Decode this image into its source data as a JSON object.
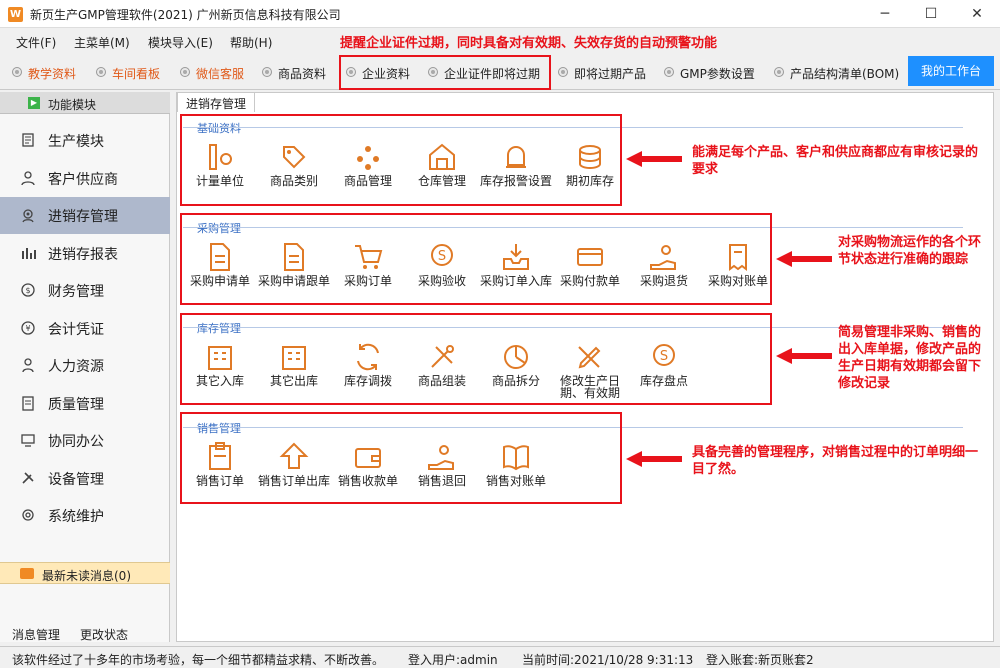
{
  "window": {
    "title": "新页生产GMP管理软件(2021) 广州新页信息科技有限公司",
    "icon_glyph": "W",
    "controls": {
      "minimize": "─",
      "maximize": "☐",
      "close": "✕"
    }
  },
  "menu": {
    "items": [
      "文件(F)",
      "主菜单(M)",
      "模块导入(E)",
      "帮助(H)"
    ]
  },
  "banner": "提醒企业证件过期，同时具备对有效期、失效存货的自动预警功能",
  "quickbar": {
    "items": [
      "教学资料",
      "车间看板",
      "微信客服",
      "商品资料",
      "企业资料",
      "企业证件即将过期",
      "即将过期产品",
      "GMP参数设置",
      "产品结构清单(BOM)"
    ],
    "workbench": "我的工作台"
  },
  "sidebar": {
    "header": "功能模块",
    "items": [
      "生产模块",
      "客户供应商",
      "进销存管理",
      "进销存报表",
      "财务管理",
      "会计凭证",
      "人力资源",
      "质量管理",
      "协同办公",
      "设备管理",
      "系统维护"
    ],
    "active_index": 2,
    "unread": "最新未读消息(0)",
    "footer": [
      "消息管理",
      "更改状态"
    ]
  },
  "main": {
    "tab": "进销存管理",
    "sections": [
      {
        "title": "基础资料",
        "items": [
          "计量单位",
          "商品类别",
          "商品管理",
          "仓库管理",
          "库存报警设置",
          "期初库存"
        ]
      },
      {
        "title": "采购管理",
        "items": [
          "采购申请单",
          "采购申请跟单",
          "采购订单",
          "采购验收",
          "采购订单入库",
          "采购付款单",
          "采购退货",
          "采购对账单"
        ]
      },
      {
        "title": "库存管理",
        "items": [
          "其它入库",
          "其它出库",
          "库存调拨",
          "商品组装",
          "商品拆分",
          "修改生产日期、有效期",
          "库存盘点"
        ]
      },
      {
        "title": "销售管理",
        "items": [
          "销售订单",
          "销售订单出库",
          "销售收款单",
          "销售退回",
          "销售对账单"
        ]
      }
    ],
    "notes": [
      "能满足每个产品、客户和供应商都应有审核记录的要求",
      "对采购物流运作的各个环节状态进行准确的跟踪",
      "简易管理非采购、销售的出入库单据，修改产品的生产日期有效期都会留下修改记录",
      "具备完善的管理程序，对销售过程中的订单明细一目了然。"
    ]
  },
  "status": {
    "slogan": "该软件经过了十多年的市场考验，每一个细节都精益求精、不断改善。",
    "user": "登入用户:admin",
    "time": "当前时间:2021/10/28 9:31:13",
    "account": "登入账套:新页账套2"
  },
  "colors": {
    "accent_orange": "#e05a1a",
    "annotation_red": "#e8131b",
    "icon_orange": "#e07a26",
    "workbench_blue": "#1e90ff",
    "section_blue": "#3a6fc4"
  }
}
